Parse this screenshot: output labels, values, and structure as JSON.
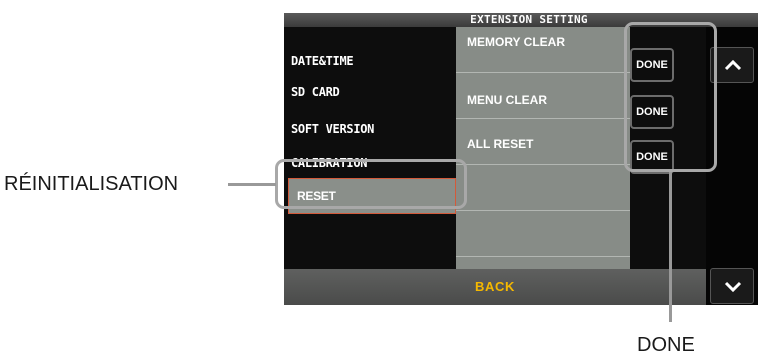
{
  "screen": {
    "title": "EXTENSION SETTING",
    "menu_items": [
      {
        "label": "DATE&TIME"
      },
      {
        "label": "SD CARD"
      },
      {
        "label": "SOFT VERSION"
      },
      {
        "label": "CALIBRATION"
      },
      {
        "label": "RESET",
        "selected": true
      }
    ],
    "options": [
      {
        "label": "MEMORY CLEAR",
        "button": "DONE"
      },
      {
        "label": "MENU CLEAR",
        "button": "DONE"
      },
      {
        "label": "ALL RESET",
        "button": "DONE"
      }
    ],
    "back_label": "BACK",
    "scroll_up_icon": "chevron-up-icon",
    "scroll_down_icon": "chevron-down-icon",
    "colors": {
      "selected_border": "#d35a3a",
      "back_text": "#f5b800",
      "panel": "#878c87"
    }
  },
  "annotations": {
    "reset_label": "RÉINITIALISATION",
    "done_label": "DONE"
  }
}
